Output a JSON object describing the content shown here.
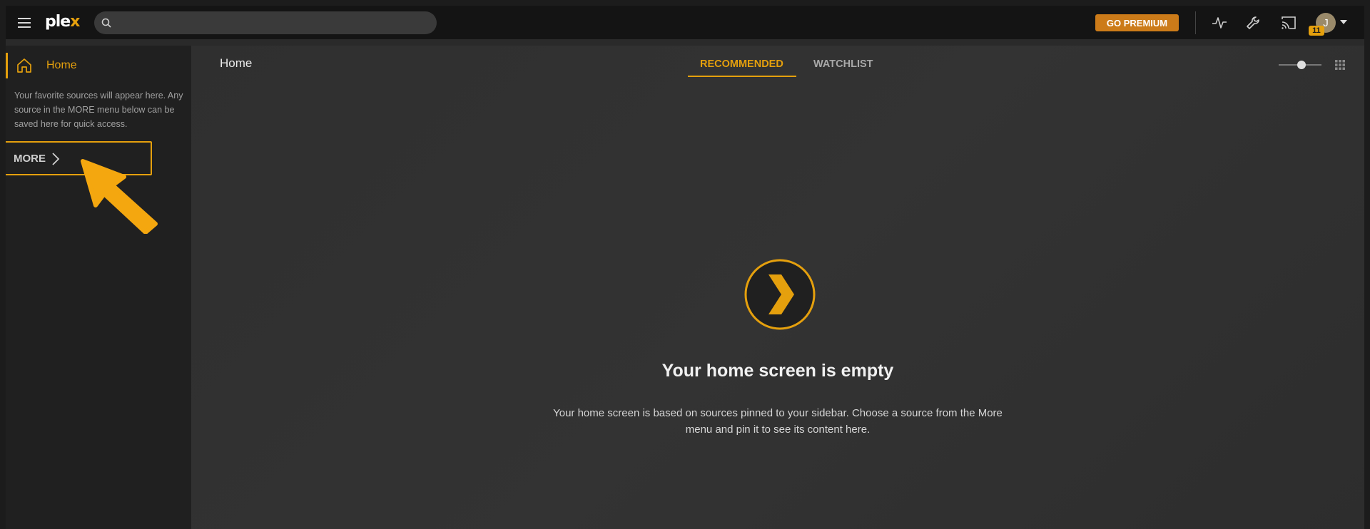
{
  "app": {
    "logo_main": "ple",
    "logo_accent": "x"
  },
  "header": {
    "search": {
      "placeholder": "",
      "value": ""
    },
    "premium_label": "GO PREMIUM",
    "icons": [
      "activity-icon",
      "settings-wrench-icon",
      "cast-icon"
    ],
    "avatar_initial": "J",
    "notification_count": "11"
  },
  "sidebar": {
    "home_label": "Home",
    "favorites_hint": "Your favorite sources will appear here. Any source in the MORE menu below can be saved here for quick access.",
    "more_label": "MORE"
  },
  "main": {
    "title": "Home",
    "tabs": [
      {
        "label": "RECOMMENDED",
        "active": true
      },
      {
        "label": "WATCHLIST",
        "active": false
      }
    ],
    "empty_title": "Your home screen is empty",
    "empty_desc": "Your home screen is based on sources pinned to your sidebar. Choose a source from the More menu and pin it to see its content here."
  },
  "colors": {
    "accent": "#e5a00d",
    "premium": "#cc7b19",
    "topbar": "#141414",
    "sidebar": "#202020",
    "main": "#303030"
  }
}
